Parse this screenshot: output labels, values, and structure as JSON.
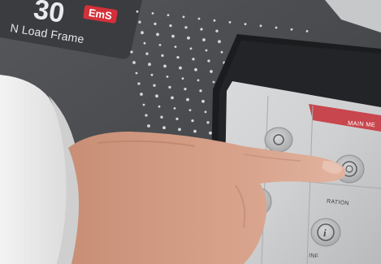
{
  "device": {
    "model_text": "N Load Frame",
    "badge_text": "EmS"
  },
  "touchscreen": {
    "header_title": "MAIN ME",
    "buttons": [
      {
        "label": "",
        "icon": "settings-icon"
      },
      {
        "label": "CALIBRATION",
        "icon": "calibration-dial-icon"
      },
      {
        "label": "",
        "icon": "document-icon"
      },
      {
        "label": "INFO",
        "icon": "info-icon"
      }
    ],
    "visible_label_fragments": [
      "RATION",
      "INF"
    ]
  },
  "colors": {
    "panel": "#4b4d50",
    "accent_red": "#d3303a",
    "screen_bezel": "#1a1b1d"
  }
}
